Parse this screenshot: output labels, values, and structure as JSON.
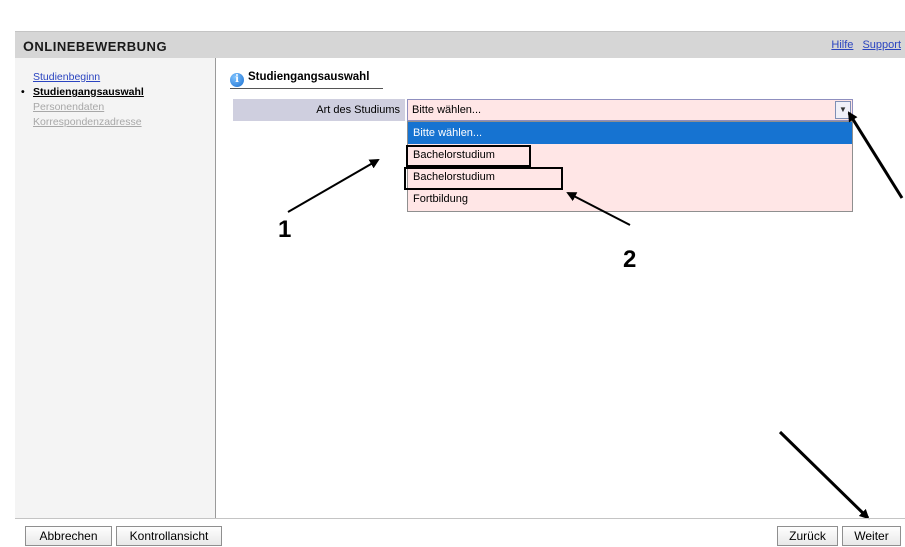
{
  "header": {
    "title_first": "O",
    "title_rest": "NLINEBEWERBUNG",
    "links": [
      "Hilfe",
      "Support"
    ]
  },
  "sidebar": {
    "items": [
      {
        "label": "Studienbeginn",
        "state": "done"
      },
      {
        "label": "Studiengangsauswahl",
        "state": "active"
      },
      {
        "label": "Personendaten",
        "state": "disabled"
      },
      {
        "label": "Korrespondenzadresse",
        "state": "disabled"
      }
    ]
  },
  "main": {
    "tab_label": "Studiengangsauswahl",
    "field_label": "Art des Studiums",
    "select_value": "Bitte wählen...",
    "options": [
      "Bitte wählen...",
      "Bachelorstudium",
      "Bachelorstudium",
      "Fortbildung"
    ],
    "selected_index": 0
  },
  "annotations": [
    "1",
    "2"
  ],
  "footer": {
    "cancel": "Abbrechen",
    "preview": "Kontrollansicht",
    "back": "Zurück",
    "next": "Weiter"
  },
  "colors": {
    "header_bg": "#d6d6d6",
    "sidebar_bg": "#f4f4f4",
    "link": "#2a44c0",
    "select_bg": "#ffe6e6",
    "selected_option": "#1673d1",
    "label_bg": "#cfcfdf"
  },
  "icons": {
    "info": "info-icon",
    "dropdown": "chevron-down-icon"
  }
}
